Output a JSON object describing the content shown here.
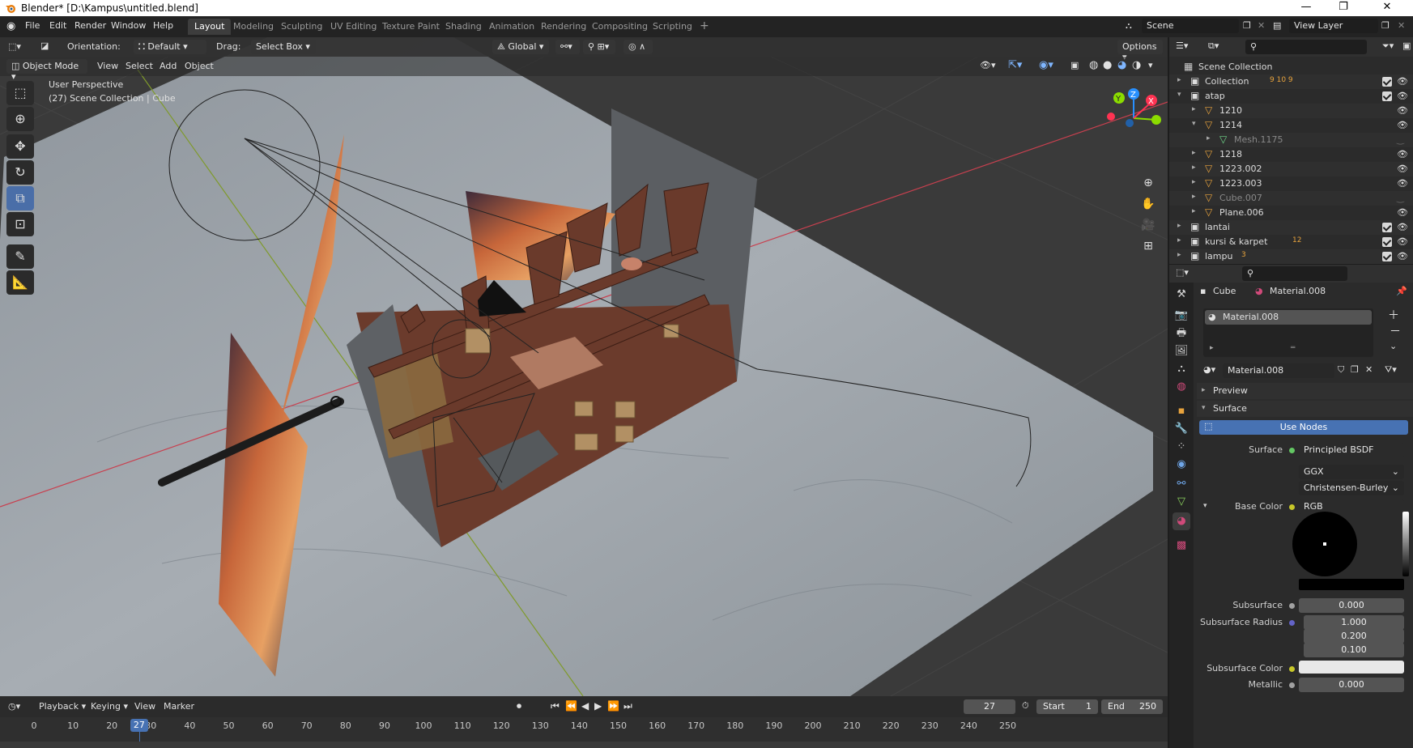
{
  "titlebar": {
    "title": "Blender* [D:\\Kampus\\untitled.blend]",
    "minimize": "—",
    "maximize": "❐",
    "close": "✕"
  },
  "menubar": {
    "items": [
      "File",
      "Edit",
      "Render",
      "Window",
      "Help"
    ]
  },
  "workspaces": {
    "tabs": [
      "Layout",
      "Modeling",
      "Sculpting",
      "UV Editing",
      "Texture Paint",
      "Shading",
      "Animation",
      "Rendering",
      "Compositing",
      "Scripting"
    ],
    "active": "Layout",
    "add": "+"
  },
  "scene": {
    "name": "Scene",
    "view_layer": "View Layer"
  },
  "tool_header": {
    "orientation_label": "Orientation:",
    "orientation_value": "Default",
    "drag_label": "Drag:",
    "drag_value": "Select Box",
    "transform": "Global",
    "options": "Options"
  },
  "viewport_header": {
    "mode": "Object Mode",
    "menus": [
      "View",
      "Select",
      "Add",
      "Object"
    ]
  },
  "viewport": {
    "overlay_line1": "User Perspective",
    "overlay_line2": "(27) Scene Collection | Cube",
    "gizmo_x": "X",
    "gizmo_y": "Y",
    "gizmo_z": "Z",
    "colors": {
      "x_axis": "#ff3352",
      "y_axis": "#8bdc00",
      "z_axis": "#2890ff",
      "floor": "#9aa1a8",
      "wall": "#5b5e62",
      "wood": "#6b3b2c"
    }
  },
  "toolbar": {
    "tools": [
      "select-box",
      "cursor",
      "move",
      "rotate",
      "scale",
      "transform",
      "annotate",
      "measure"
    ],
    "active": "scale"
  },
  "outliner": {
    "root": "Scene Collection",
    "rows": [
      {
        "label": "Collection",
        "indent": 1,
        "arrow": "▸",
        "badge": "9 10 9",
        "visible": true
      },
      {
        "label": "atap",
        "indent": 1,
        "arrow": "▾",
        "visible": true
      },
      {
        "label": "1210",
        "indent": 2,
        "arrow": "▸",
        "visible": true
      },
      {
        "label": "1214",
        "indent": 2,
        "arrow": "▾",
        "visible": true
      },
      {
        "label": "Mesh.1175",
        "indent": 3,
        "arrow": "▸",
        "visible": false
      },
      {
        "label": "1218",
        "indent": 2,
        "arrow": "▸",
        "visible": true
      },
      {
        "label": "1223.002",
        "indent": 2,
        "arrow": "▸",
        "visible": true
      },
      {
        "label": "1223.003",
        "indent": 2,
        "arrow": "▸",
        "visible": true
      },
      {
        "label": "Cube.007",
        "indent": 2,
        "arrow": "▸",
        "visible": false
      },
      {
        "label": "Plane.006",
        "indent": 2,
        "arrow": "▸",
        "visible": true
      },
      {
        "label": "lantai",
        "indent": 1,
        "arrow": "▸",
        "visible": true
      },
      {
        "label": "kursi & karpet",
        "indent": 1,
        "arrow": "▸",
        "badge": "12",
        "visible": true
      },
      {
        "label": "lampu",
        "indent": 1,
        "arrow": "▸",
        "badge": "3",
        "visible": true
      }
    ]
  },
  "properties": {
    "object": "Cube",
    "material": "Material.008",
    "slot": "Material.008",
    "datablock": "Material.008",
    "panels": {
      "preview": "Preview",
      "surface": "Surface"
    },
    "use_nodes": "Use Nodes",
    "surface_label": "Surface",
    "surface_value": "Principled BSDF",
    "distribution": "GGX",
    "subsurface_method": "Christensen-Burley",
    "base_color_label": "Base Color",
    "base_color_value": "RGB",
    "fields": [
      {
        "label": "Subsurface",
        "value": "0.000"
      },
      {
        "label": "Subsurface Radius",
        "value": "1.000"
      },
      {
        "label": "",
        "value": "0.200"
      },
      {
        "label": "",
        "value": "0.100"
      },
      {
        "label": "Subsurface Color",
        "value": ""
      },
      {
        "label": "Metallic",
        "value": "0.000"
      }
    ]
  },
  "timeline": {
    "menus": [
      "Playback",
      "Keying",
      "View",
      "Marker"
    ],
    "current_frame": "27",
    "start_label": "Start",
    "start": "1",
    "end_label": "End",
    "end": "250",
    "ticks": [
      "0",
      "10",
      "20",
      "30",
      "40",
      "50",
      "60",
      "70",
      "80",
      "90",
      "100",
      "110",
      "120",
      "130",
      "140",
      "150",
      "160",
      "170",
      "180",
      "190",
      "200",
      "210",
      "220",
      "230",
      "240",
      "250"
    ],
    "playhead": "27"
  }
}
